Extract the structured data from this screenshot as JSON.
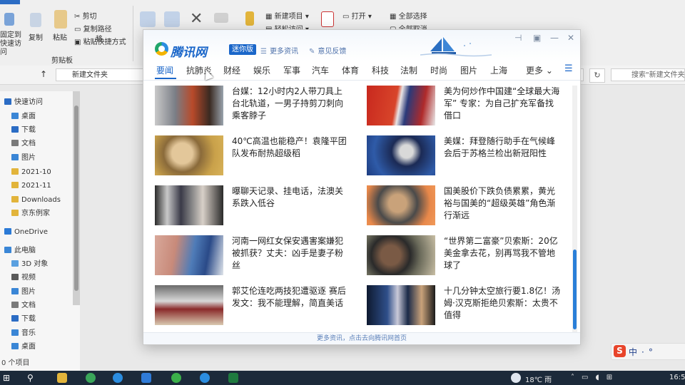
{
  "explorer": {
    "ribbon": {
      "pin_label": "固定到快速访问",
      "copy_label": "复制",
      "paste_label": "粘贴",
      "cut_label": "剪切",
      "copy_path_label": "复制路径",
      "paste_shortcut_label": "粘贴快捷方式",
      "move_label": "移",
      "clipboard_group": "剪贴板",
      "new_item_label": "新建项目",
      "easy_access_label": "轻松访问",
      "open_label": "打开",
      "select_all_label": "全部选择",
      "select_none_label": "全部取消"
    },
    "address": {
      "path": "新建文件夹",
      "search_placeholder": "搜索\"新建文件夹\""
    },
    "sidebar": {
      "items": [
        {
          "label": "快速访问",
          "color": "#2b6cc4"
        },
        {
          "label": "桌面",
          "color": "#3a86d6"
        },
        {
          "label": "下载",
          "color": "#2b6cc4"
        },
        {
          "label": "文档",
          "color": "#7a7a7a"
        },
        {
          "label": "图片",
          "color": "#3a86d6"
        },
        {
          "label": "2021-10",
          "color": "#e2b43b"
        },
        {
          "label": "2021-11",
          "color": "#e2b43b"
        },
        {
          "label": "Downloads",
          "color": "#e2b43b"
        },
        {
          "label": "京东例家",
          "color": "#e2b43b"
        },
        {
          "label": "OneDrive",
          "color": "#2b7ad6"
        },
        {
          "label": "此电脑",
          "color": "#3a86d6"
        },
        {
          "label": "3D 对象",
          "color": "#5aa0e0"
        },
        {
          "label": "视频",
          "color": "#5a5a5a"
        },
        {
          "label": "图片",
          "color": "#3a86d6"
        },
        {
          "label": "文档",
          "color": "#7a7a7a"
        },
        {
          "label": "下载",
          "color": "#2b6cc4"
        },
        {
          "label": "音乐",
          "color": "#3a86d6"
        },
        {
          "label": "桌面",
          "color": "#3a86d6"
        }
      ]
    },
    "status": "0 个项目"
  },
  "tencent": {
    "brand": "腾讯网",
    "mini_badge": "迷你版",
    "more_news_link": "更多资讯",
    "feedback_link": "意见反馈",
    "nav": [
      "要闻",
      "抗肺炎",
      "财经",
      "娱乐",
      "军事",
      "汽车",
      "体育",
      "科技",
      "法制",
      "时尚",
      "图片",
      "上海"
    ],
    "nav_more": "更多",
    "active_nav": "要闻",
    "news": [
      {
        "title": "台媒：12小时内2人带刀具上台北轨道，一男子持剪刀刺向乘客脖子",
        "thumb": "subway"
      },
      {
        "title": "美为何炒作中国建“全球最大海军” 专家：为自己扩充军备找借口",
        "thumb": "flags"
      },
      {
        "title": "40℃高温也能稳产！袁隆平团队发布耐热超级稻",
        "thumb": "portrait"
      },
      {
        "title": "美媒：拜登随行助手在气候峰会后于苏格兰检出新冠阳性",
        "thumb": "suit"
      },
      {
        "title": "曝聊天记录、挂电话，法澳关系跌入低谷",
        "thumb": "leaders"
      },
      {
        "title": "国美股价下跌负债累累，黄光裕与国美的“超级英雄”角色渐行渐远",
        "thumb": "bald"
      },
      {
        "title": "河南一网红女保安遇害案嫌犯被抓获？丈夫：凶手是妻子粉丝",
        "thumb": "woman"
      },
      {
        "title": "“世界第二富豪”贝索斯：20亿美金拿去花，别再骂我不管地球了",
        "thumb": "money"
      },
      {
        "title": "郭艾伦连吃两技犯遭驱逐 赛后发文：我不能理解，简直美话",
        "thumb": "basketball"
      },
      {
        "title": "十几分钟太空旅行要1.8亿！汤姆·汉克斯拒绝贝索斯：太贵不值得",
        "thumb": "space"
      }
    ],
    "footer": "更多资讯，点击去向腾讯网首页"
  },
  "taskbar": {
    "weather": "18℃ 雨",
    "time": "16:5"
  },
  "ime": {
    "logo": "S",
    "lang": "中·°"
  }
}
